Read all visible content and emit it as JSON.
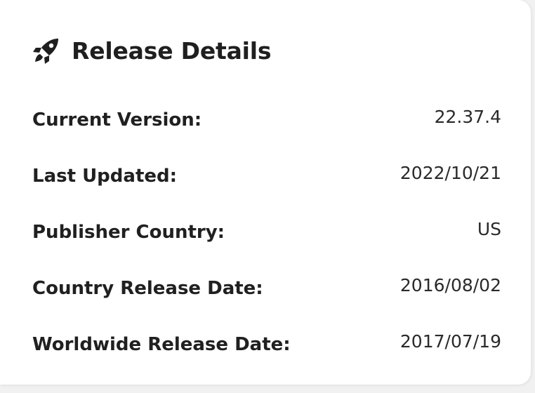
{
  "panel": {
    "title": "Release Details",
    "icon": "rocket-icon"
  },
  "rows": [
    {
      "label": "Current Version:",
      "value": "22.37.4"
    },
    {
      "label": "Last Updated:",
      "value": "2022/10/21"
    },
    {
      "label": "Publisher Country:",
      "value": "US"
    },
    {
      "label": "Country Release Date:",
      "value": "2016/08/02"
    },
    {
      "label": "Worldwide Release Date:",
      "value": "2017/07/19"
    }
  ]
}
